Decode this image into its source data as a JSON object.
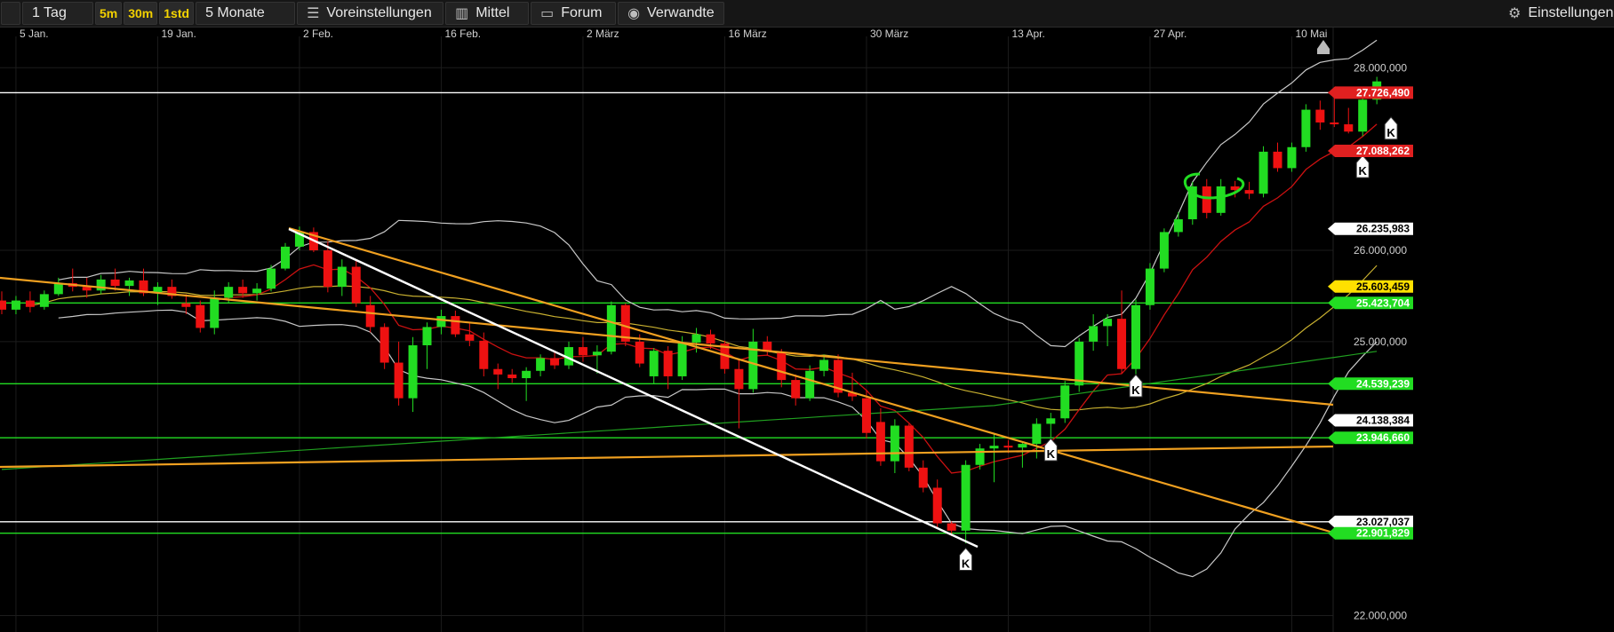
{
  "toolbar": {
    "timeframe": "1 Tag",
    "resolutions": [
      "5m",
      "30m",
      "1std"
    ],
    "range": "5 Monate",
    "presets": "Voreinstellungen",
    "indicator": "Mittel",
    "forum": "Forum",
    "related": "Verwandte",
    "settings": "Einstellungen",
    "icons": {
      "presets": "sliders-icon",
      "indicator": "candlestick-icon",
      "forum": "speech-bubble-icon",
      "related": "eye-icon",
      "settings": "gear-icon"
    }
  },
  "colors": {
    "up": "#22dd22",
    "down": "#ee1111",
    "bb": "#c8c8c8",
    "ma": "#c8b030",
    "ema": "#cc1111",
    "ma_long": "#20a020",
    "orange": "#f0a020",
    "green_line": "#22dd22",
    "white_line": "#ffffff"
  },
  "chart_data": {
    "type": "candlestick",
    "x_labels": [
      "5 Jan.",
      "19 Jan.",
      "2 Feb.",
      "16 Feb.",
      "2 März",
      "16 März",
      "30 März",
      "13 Apr.",
      "27 Apr.",
      "10 Mai"
    ],
    "y_ticks": [
      22000000,
      25000000,
      26000000,
      28000000
    ],
    "y_tick_labels": [
      "22.000,000",
      "25.000,000",
      "26.000,000",
      "28.000,000"
    ],
    "ylim": [
      21820000,
      28440000
    ],
    "price_labels": [
      {
        "text": "27.726,490",
        "value": 27726490,
        "color": "#e02020",
        "fg": "#ffffff"
      },
      {
        "text": "27.088,262",
        "value": 27088262,
        "color": "#e02020",
        "fg": "#ffffff"
      },
      {
        "text": "26.235,983",
        "value": 26235983,
        "color": "#ffffff",
        "fg": "#000000"
      },
      {
        "text": "25.603,459",
        "value": 25603459,
        "color": "#ffe000",
        "fg": "#000000"
      },
      {
        "text": "25.423,704",
        "value": 25423704,
        "color": "#22dd22",
        "fg": "#ffffff"
      },
      {
        "text": "24.539,239",
        "value": 24539239,
        "color": "#22dd22",
        "fg": "#ffffff"
      },
      {
        "text": "24.138,384",
        "value": 24138384,
        "color": "#ffffff",
        "fg": "#000000"
      },
      {
        "text": "23.946,660",
        "value": 23946660,
        "color": "#22dd22",
        "fg": "#ffffff"
      },
      {
        "text": "23.027,037",
        "value": 23027037,
        "color": "#ffffff",
        "fg": "#000000"
      },
      {
        "text": "22.901,829",
        "value": 22901829,
        "color": "#22dd22",
        "fg": "#ffffff"
      }
    ],
    "horizontal_lines": [
      {
        "value": 27726490,
        "color": "#ffffff"
      },
      {
        "value": 25423704,
        "color": "#22dd22"
      },
      {
        "value": 24539239,
        "color": "#22dd22"
      },
      {
        "value": 23946660,
        "color": "#22dd22"
      },
      {
        "value": 23027037,
        "color": "#ffffff"
      },
      {
        "value": 22901829,
        "color": "#22dd22"
      }
    ],
    "candles": [
      {
        "x": "2 Jan.",
        "o": 25450000,
        "h": 25550000,
        "l": 25300000,
        "c": 25350000
      },
      {
        "x": "5 Jan.",
        "o": 25350000,
        "h": 25500000,
        "l": 25300000,
        "c": 25450000
      },
      {
        "x": "6 Jan.",
        "o": 25450000,
        "h": 25550000,
        "l": 25320000,
        "c": 25380000
      },
      {
        "x": "7 Jan.",
        "o": 25380000,
        "h": 25560000,
        "l": 25350000,
        "c": 25520000
      },
      {
        "x": "8 Jan.",
        "o": 25520000,
        "h": 25700000,
        "l": 25500000,
        "c": 25640000
      },
      {
        "x": "9 Jan.",
        "o": 25640000,
        "h": 25800000,
        "l": 25550000,
        "c": 25600000
      },
      {
        "x": "12 Jan.",
        "o": 25600000,
        "h": 25700000,
        "l": 25480000,
        "c": 25560000
      },
      {
        "x": "13 Jan.",
        "o": 25560000,
        "h": 25730000,
        "l": 25520000,
        "c": 25680000
      },
      {
        "x": "14 Jan.",
        "o": 25680000,
        "h": 25800000,
        "l": 25560000,
        "c": 25610000
      },
      {
        "x": "15 Jan.",
        "o": 25610000,
        "h": 25700000,
        "l": 25500000,
        "c": 25670000
      },
      {
        "x": "16 Jan.",
        "o": 25670000,
        "h": 25800000,
        "l": 25500000,
        "c": 25530000
      },
      {
        "x": "19 Jan.",
        "o": 25530000,
        "h": 25650000,
        "l": 25400000,
        "c": 25600000
      },
      {
        "x": "20 Jan.",
        "o": 25600000,
        "h": 25680000,
        "l": 25470000,
        "c": 25500000
      },
      {
        "x": "21 Jan.",
        "o": 25420000,
        "h": 25520000,
        "l": 25300000,
        "c": 25380000
      },
      {
        "x": "22 Jan.",
        "o": 25400000,
        "h": 25450000,
        "l": 25100000,
        "c": 25150000
      },
      {
        "x": "23 Jan.",
        "o": 25150000,
        "h": 25560000,
        "l": 25080000,
        "c": 25480000
      },
      {
        "x": "26 Jan.",
        "o": 25480000,
        "h": 25650000,
        "l": 25420000,
        "c": 25600000
      },
      {
        "x": "27 Jan.",
        "o": 25600000,
        "h": 25680000,
        "l": 25480000,
        "c": 25530000
      },
      {
        "x": "28 Jan.",
        "o": 25530000,
        "h": 25640000,
        "l": 25450000,
        "c": 25580000
      },
      {
        "x": "29 Jan.",
        "o": 25580000,
        "h": 25840000,
        "l": 25550000,
        "c": 25800000
      },
      {
        "x": "30 Jan.",
        "o": 25800000,
        "h": 26080000,
        "l": 25780000,
        "c": 26040000
      },
      {
        "x": "2 Feb.",
        "o": 26040000,
        "h": 26260000,
        "l": 26000000,
        "c": 26200000
      },
      {
        "x": "3 Feb.",
        "o": 26200000,
        "h": 26250000,
        "l": 25980000,
        "c": 26000000
      },
      {
        "x": "4 Feb.",
        "o": 26000000,
        "h": 26100000,
        "l": 25540000,
        "c": 25600000
      },
      {
        "x": "5 Feb.",
        "o": 25600000,
        "h": 25900000,
        "l": 25500000,
        "c": 25820000
      },
      {
        "x": "6 Feb.",
        "o": 25820000,
        "h": 25900000,
        "l": 25380000,
        "c": 25420000
      },
      {
        "x": "9 Feb.",
        "o": 25400000,
        "h": 25500000,
        "l": 25100000,
        "c": 25160000
      },
      {
        "x": "10 Feb.",
        "o": 25160000,
        "h": 25200000,
        "l": 24700000,
        "c": 24770000
      },
      {
        "x": "11 Feb.",
        "o": 24770000,
        "h": 25000000,
        "l": 24300000,
        "c": 24380000
      },
      {
        "x": "12 Feb.",
        "o": 24380000,
        "h": 25050000,
        "l": 24230000,
        "c": 24960000
      },
      {
        "x": "13 Feb.",
        "o": 24960000,
        "h": 25210000,
        "l": 24700000,
        "c": 25160000
      },
      {
        "x": "16 Feb.",
        "o": 25160000,
        "h": 25350000,
        "l": 25080000,
        "c": 25280000
      },
      {
        "x": "17 Feb.",
        "o": 25280000,
        "h": 25340000,
        "l": 25050000,
        "c": 25080000
      },
      {
        "x": "18 Feb.",
        "o": 25080000,
        "h": 25200000,
        "l": 24950000,
        "c": 25010000
      },
      {
        "x": "19 Feb.",
        "o": 25010000,
        "h": 25100000,
        "l": 24620000,
        "c": 24700000
      },
      {
        "x": "20 Feb.",
        "o": 24700000,
        "h": 24760000,
        "l": 24480000,
        "c": 24640000
      },
      {
        "x": "23 Feb.",
        "o": 24640000,
        "h": 24700000,
        "l": 24550000,
        "c": 24600000
      },
      {
        "x": "24 Feb.",
        "o": 24600000,
        "h": 24720000,
        "l": 24350000,
        "c": 24680000
      },
      {
        "x": "25 Feb.",
        "o": 24680000,
        "h": 24860000,
        "l": 24620000,
        "c": 24820000
      },
      {
        "x": "26 Feb.",
        "o": 24820000,
        "h": 24900000,
        "l": 24700000,
        "c": 24740000
      },
      {
        "x": "27 Feb.",
        "o": 24740000,
        "h": 25000000,
        "l": 24700000,
        "c": 24940000
      },
      {
        "x": "2 März",
        "o": 24940000,
        "h": 25050000,
        "l": 24780000,
        "c": 24850000
      },
      {
        "x": "3 März",
        "o": 24850000,
        "h": 24960000,
        "l": 24650000,
        "c": 24890000
      },
      {
        "x": "4 März",
        "o": 24890000,
        "h": 25440000,
        "l": 24860000,
        "c": 25400000
      },
      {
        "x": "5 März",
        "o": 25400000,
        "h": 25420000,
        "l": 24950000,
        "c": 25000000
      },
      {
        "x": "6 März",
        "o": 25000000,
        "h": 25080000,
        "l": 24720000,
        "c": 24760000
      },
      {
        "x": "9 März",
        "o": 24620000,
        "h": 24930000,
        "l": 24540000,
        "c": 24900000
      },
      {
        "x": "10 März",
        "o": 24900000,
        "h": 24950000,
        "l": 24480000,
        "c": 24620000
      },
      {
        "x": "11 März",
        "o": 24620000,
        "h": 25060000,
        "l": 24580000,
        "c": 24990000
      },
      {
        "x": "12 März",
        "o": 24990000,
        "h": 25150000,
        "l": 24880000,
        "c": 25080000
      },
      {
        "x": "13 März",
        "o": 25080000,
        "h": 25130000,
        "l": 24920000,
        "c": 24980000
      },
      {
        "x": "16 März",
        "o": 24980000,
        "h": 25010000,
        "l": 24650000,
        "c": 24700000
      },
      {
        "x": "17 März",
        "o": 24700000,
        "h": 24800000,
        "l": 24050000,
        "c": 24480000
      },
      {
        "x": "18 März",
        "o": 24480000,
        "h": 25140000,
        "l": 24440000,
        "c": 25000000
      },
      {
        "x": "19 März",
        "o": 25000000,
        "h": 25060000,
        "l": 24850000,
        "c": 24890000
      },
      {
        "x": "20 März",
        "o": 24880000,
        "h": 24920000,
        "l": 24500000,
        "c": 24580000
      },
      {
        "x": "23 März",
        "o": 24580000,
        "h": 24640000,
        "l": 24300000,
        "c": 24380000
      },
      {
        "x": "24 März",
        "o": 24380000,
        "h": 24740000,
        "l": 24350000,
        "c": 24680000
      },
      {
        "x": "25 März",
        "o": 24680000,
        "h": 24860000,
        "l": 24620000,
        "c": 24800000
      },
      {
        "x": "26 März",
        "o": 24800000,
        "h": 24860000,
        "l": 24390000,
        "c": 24440000
      },
      {
        "x": "27 März",
        "o": 24440000,
        "h": 24660000,
        "l": 24350000,
        "c": 24400000
      },
      {
        "x": "30 März",
        "o": 24380000,
        "h": 24470000,
        "l": 23940000,
        "c": 24000000
      },
      {
        "x": "31 März",
        "o": 24120000,
        "h": 24270000,
        "l": 23640000,
        "c": 23690000
      },
      {
        "x": "1 Apr.",
        "o": 23690000,
        "h": 24150000,
        "l": 23560000,
        "c": 24080000
      },
      {
        "x": "2 Apr.",
        "o": 24080000,
        "h": 24100000,
        "l": 23580000,
        "c": 23620000
      },
      {
        "x": "3 Apr.",
        "o": 23620000,
        "h": 23700000,
        "l": 23350000,
        "c": 23400000
      },
      {
        "x": "6 Apr.",
        "o": 23400000,
        "h": 23490000,
        "l": 22950000,
        "c": 23010000
      },
      {
        "x": "7 Apr.",
        "o": 23010000,
        "h": 23030000,
        "l": 22870000,
        "c": 22930000
      },
      {
        "x": "8 Apr.",
        "o": 22930000,
        "h": 23700000,
        "l": 22790000,
        "c": 23650000
      },
      {
        "x": "9 Apr.",
        "o": 23650000,
        "h": 23880000,
        "l": 23600000,
        "c": 23830000
      },
      {
        "x": "10 Apr.",
        "o": 23830000,
        "h": 23990000,
        "l": 23460000,
        "c": 23860000
      },
      {
        "x": "13 Apr.",
        "o": 23860000,
        "h": 23920000,
        "l": 23780000,
        "c": 23840000
      },
      {
        "x": "14 Apr.",
        "o": 23840000,
        "h": 23900000,
        "l": 23620000,
        "c": 23880000
      },
      {
        "x": "15 Apr.",
        "o": 23880000,
        "h": 24160000,
        "l": 23720000,
        "c": 24100000
      },
      {
        "x": "16 Apr.",
        "o": 24100000,
        "h": 24220000,
        "l": 23860000,
        "c": 24160000
      },
      {
        "x": "17 Apr.",
        "o": 24160000,
        "h": 24570000,
        "l": 24110000,
        "c": 24520000
      },
      {
        "x": "20 Apr.",
        "o": 24520000,
        "h": 25040000,
        "l": 24450000,
        "c": 25000000
      },
      {
        "x": "21 Apr.",
        "o": 25000000,
        "h": 25300000,
        "l": 24900000,
        "c": 25170000
      },
      {
        "x": "22 Apr.",
        "o": 25170000,
        "h": 25300000,
        "l": 24950000,
        "c": 25250000
      },
      {
        "x": "23 Apr.",
        "o": 25250000,
        "h": 25560000,
        "l": 24650000,
        "c": 24700000
      },
      {
        "x": "24 Apr.",
        "o": 24700000,
        "h": 25460000,
        "l": 24630000,
        "c": 25400000
      },
      {
        "x": "27 Apr.",
        "o": 25400000,
        "h": 25860000,
        "l": 25350000,
        "c": 25800000
      },
      {
        "x": "28 Apr.",
        "o": 25800000,
        "h": 26240000,
        "l": 25760000,
        "c": 26200000
      },
      {
        "x": "29 Apr.",
        "o": 26200000,
        "h": 26420000,
        "l": 26150000,
        "c": 26340000
      },
      {
        "x": "30 Apr.",
        "o": 26340000,
        "h": 26750000,
        "l": 26280000,
        "c": 26700000
      },
      {
        "x": "1 Mai",
        "o": 26700000,
        "h": 26780000,
        "l": 26350000,
        "c": 26410000
      },
      {
        "x": "4 Mai",
        "o": 26410000,
        "h": 26780000,
        "l": 26380000,
        "c": 26700000
      },
      {
        "x": "5 Mai",
        "o": 26700000,
        "h": 26760000,
        "l": 26580000,
        "c": 26660000
      },
      {
        "x": "6 Mai",
        "o": 26660000,
        "h": 26750000,
        "l": 26560000,
        "c": 26620000
      },
      {
        "x": "7 Mai",
        "o": 26620000,
        "h": 27140000,
        "l": 26580000,
        "c": 27080000
      },
      {
        "x": "8 Mai",
        "o": 27080000,
        "h": 27180000,
        "l": 26860000,
        "c": 26900000
      },
      {
        "x": "11 Mai",
        "o": 26900000,
        "h": 27180000,
        "l": 26860000,
        "c": 27130000
      },
      {
        "x": "12 Mai",
        "o": 27130000,
        "h": 27600000,
        "l": 27080000,
        "c": 27540000
      },
      {
        "x": "13 Mai",
        "o": 27540000,
        "h": 27640000,
        "l": 27320000,
        "c": 27400000
      },
      {
        "x": "14 Mai",
        "o": 27400000,
        "h": 27740000,
        "l": 27350000,
        "c": 27380000
      },
      {
        "x": "15 Mai",
        "o": 27380000,
        "h": 27560000,
        "l": 27280000,
        "c": 27300000
      },
      {
        "x": "18 Mai",
        "o": 27300000,
        "h": 27700000,
        "l": 27250000,
        "c": 27650000
      },
      {
        "x": "19 Mai",
        "o": 27650000,
        "h": 27900000,
        "l": 27600000,
        "c": 27850000
      }
    ],
    "markers": [
      {
        "label": "K",
        "candle": 68,
        "value": 22700000,
        "dir": "up"
      },
      {
        "label": "K",
        "candle": 74,
        "value": 23900000,
        "dir": "up"
      },
      {
        "label": "K",
        "candle": 80,
        "value": 24600000,
        "dir": "up"
      },
      {
        "label": "K",
        "candle": 96,
        "value": 27000000,
        "dir": "up"
      },
      {
        "label": "K",
        "candle": 98,
        "value": 27420000,
        "dir": "up"
      }
    ]
  }
}
